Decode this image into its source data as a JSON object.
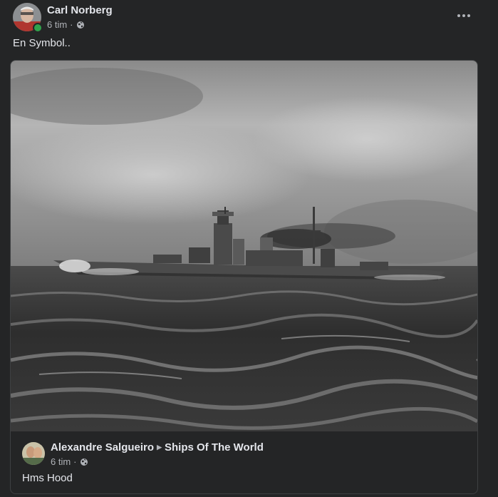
{
  "post": {
    "author": "Carl Norberg",
    "time": "6 tim",
    "separator": "·",
    "privacy_icon": "globe-icon",
    "text": "En Symbol..",
    "more_icon": "more-options-icon"
  },
  "shared_post": {
    "author": "Alexandre Salgueiro",
    "group": "Ships Of The World",
    "time": "6 tim",
    "separator": "·",
    "privacy_icon": "globe-icon",
    "text": "Hms Hood"
  },
  "colors": {
    "background": "#242526",
    "text_primary": "#e4e6eb",
    "text_secondary": "#b0b3b8",
    "online": "#31a24c",
    "border": "#3e4042"
  }
}
